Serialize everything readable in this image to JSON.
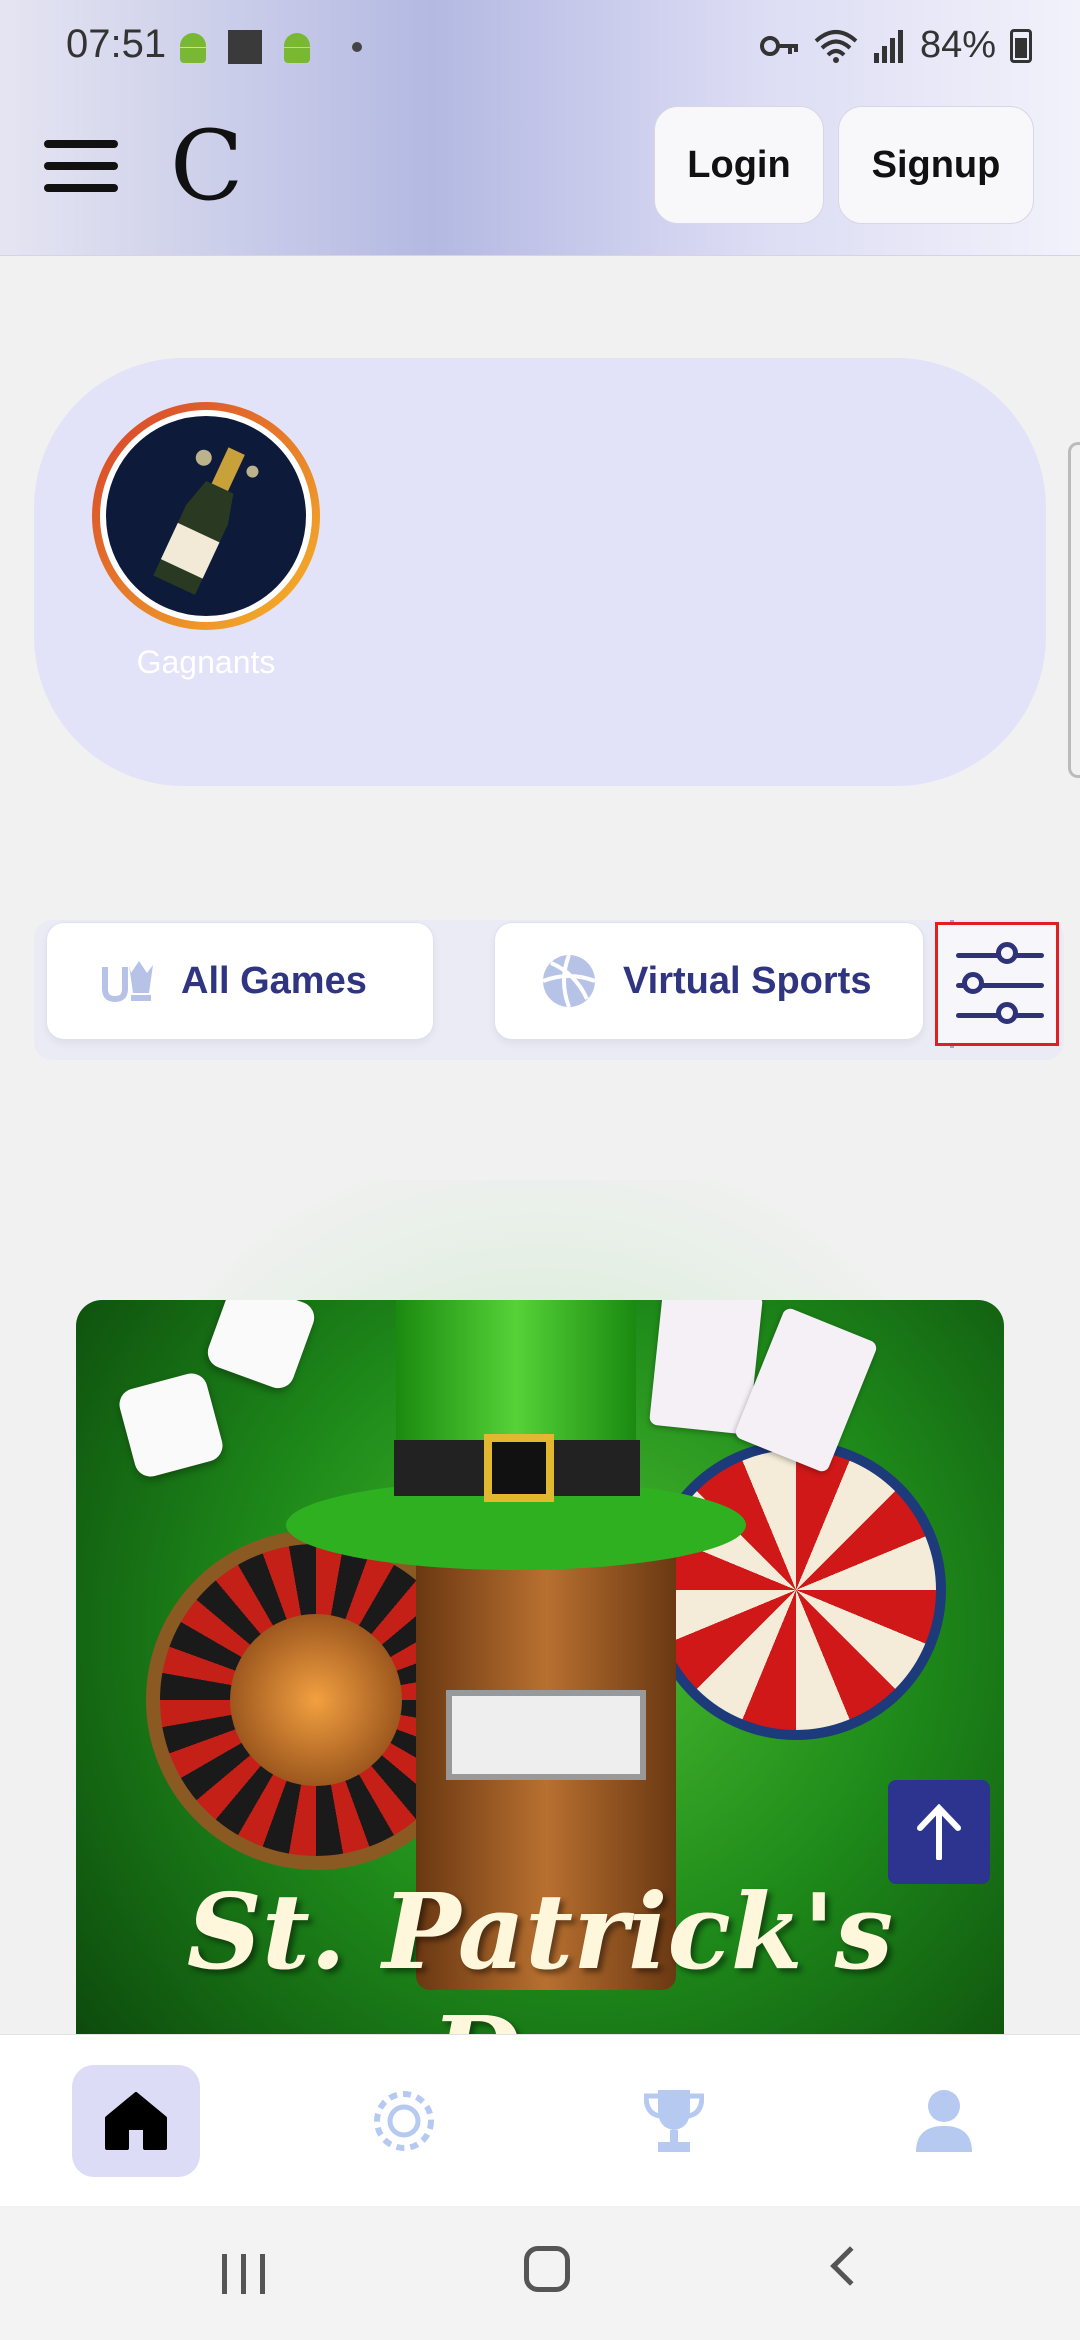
{
  "status_bar": {
    "time": "07:51",
    "battery": "84%"
  },
  "header": {
    "logo": "C",
    "login_label": "Login",
    "signup_label": "Signup"
  },
  "stories": [
    {
      "label": "Gagnants"
    }
  ],
  "categories": {
    "items": [
      {
        "label": "All Games",
        "icon": "games-icon"
      },
      {
        "label": "Virtual Sports",
        "icon": "volleyball-icon"
      }
    ],
    "filter_icon": "sliders-icon"
  },
  "banner": {
    "title": "St. Patrick's Day"
  },
  "bottom_nav": [
    "home-icon",
    "casino-chip-icon",
    "trophy-icon",
    "user-icon"
  ],
  "colors": {
    "accent": "#2e3378",
    "selected_nav_bg": "#dcdcf7",
    "stories_bg": "#e2e2f8"
  }
}
